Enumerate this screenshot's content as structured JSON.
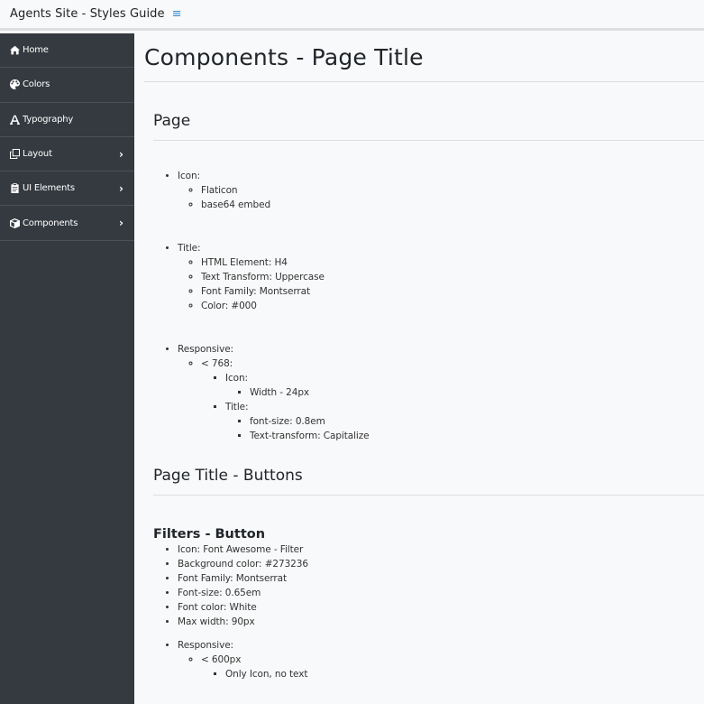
{
  "header": {
    "brand": "Agents Site - Styles Guide",
    "menu_icon": "≡"
  },
  "sidebar": {
    "items": [
      {
        "label": "Home",
        "icon": "home-icon",
        "has_submenu": false
      },
      {
        "label": "Colors",
        "icon": "palette-icon",
        "has_submenu": false
      },
      {
        "label": "Typography",
        "icon": "font-icon",
        "has_submenu": false
      },
      {
        "label": "Layout",
        "icon": "clone-icon",
        "has_submenu": true
      },
      {
        "label": "UI Elements",
        "icon": "clipboard-icon",
        "has_submenu": true
      },
      {
        "label": "Components",
        "icon": "cube-icon",
        "has_submenu": true
      }
    ],
    "chevron": "›"
  },
  "main": {
    "title": "Components - Page Title",
    "page_section": {
      "title": "Page",
      "icon": {
        "label": "Icon:",
        "items": [
          "Flaticon",
          "base64 embed"
        ]
      },
      "title_group": {
        "label": "Title:",
        "items": [
          "HTML Element: H4",
          "Text Transform: Uppercase",
          "Font Family: Montserrat",
          "Color: #000"
        ]
      },
      "responsive": {
        "label": "Responsive:",
        "breakpoint": "< 768:",
        "icon_label": "Icon:",
        "icon_items": [
          "Width - 24px"
        ],
        "title_label": "Title:",
        "title_items": [
          "font-size: 0.8em",
          "Text-transform: Capitalize"
        ]
      }
    },
    "buttons_section": {
      "title": "Page Title - Buttons",
      "filters": {
        "title": "Filters - Button",
        "items": [
          "Icon: Font Awesome - Filter",
          "Background color: #273236",
          "Font Family: Montserrat",
          "Font-size: 0.65em",
          "Font color: White",
          "Max width: 90px"
        ],
        "responsive_label": "Responsive:",
        "breakpoint": "< 600px",
        "breakpoint_items": [
          "Only Icon, no text"
        ]
      }
    }
  }
}
